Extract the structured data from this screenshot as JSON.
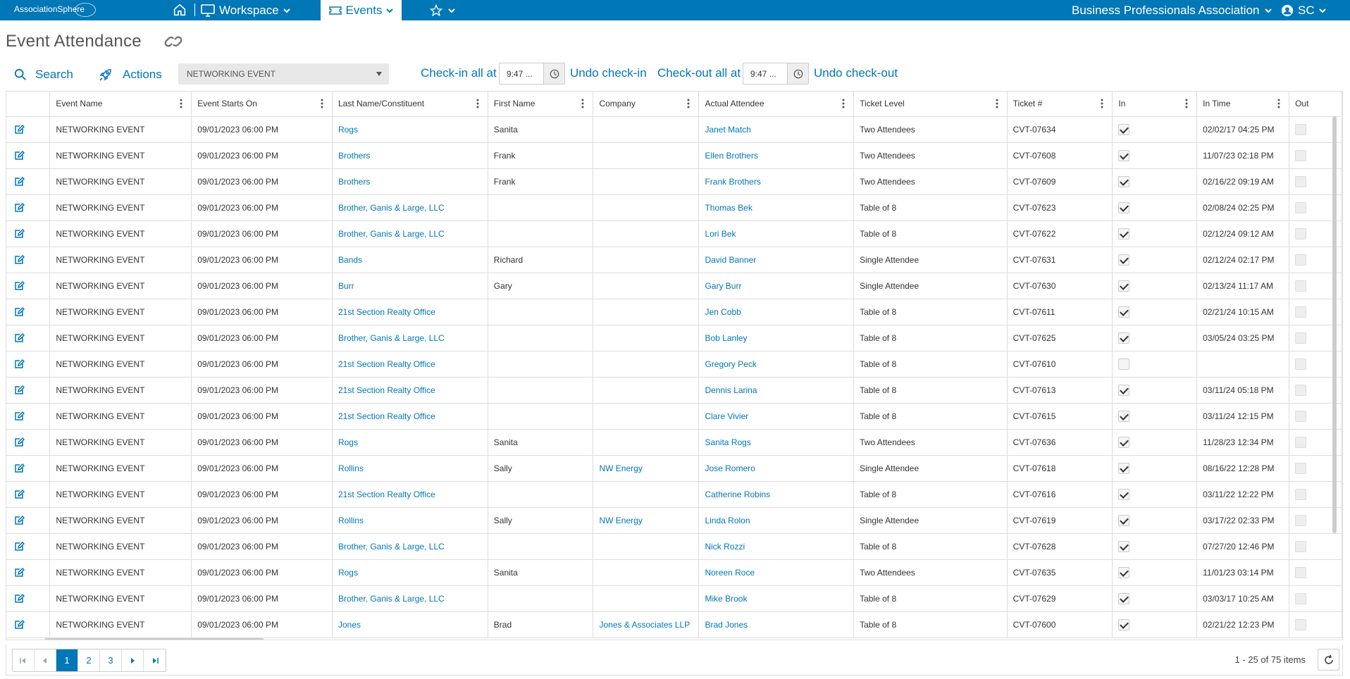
{
  "topbar": {
    "logo_text": "AssociationSphere",
    "workspace_label": "Workspace",
    "events_label": "Events",
    "org_name": "Business Professionals Association",
    "user_initials": "SC"
  },
  "page": {
    "title": "Event Attendance"
  },
  "toolbar": {
    "search_label": "Search",
    "actions_label": "Actions",
    "event_selected": "NETWORKING EVENT",
    "checkin_label": "Check-in all at",
    "checkin_time": "9:47 ...",
    "undo_checkin_label": "Undo check-in",
    "checkout_label": "Check-out all at",
    "checkout_time": "9:47 ...",
    "undo_checkout_label": "Undo check-out"
  },
  "grid": {
    "columns": [
      "Event Name",
      "Event Starts On",
      "Last Name/Constituent",
      "First Name",
      "Company",
      "Actual Attendee",
      "Ticket Level",
      "Ticket #",
      "In",
      "In Time",
      "Out"
    ],
    "rows": [
      {
        "event": "NETWORKING EVENT",
        "starts": "09/01/2023 06:00 PM",
        "last": "Rogs",
        "first": "Sanita",
        "company": "",
        "attendee": "Janet Match",
        "level": "Two Attendees",
        "ticket": "CVT-07634",
        "in": true,
        "in_time": "02/02/17 04:25 PM"
      },
      {
        "event": "NETWORKING EVENT",
        "starts": "09/01/2023 06:00 PM",
        "last": "Brothers",
        "first": "Frank",
        "company": "",
        "attendee": "Ellen Brothers",
        "level": "Two Attendees",
        "ticket": "CVT-07608",
        "in": true,
        "in_time": "11/07/23 02:18 PM"
      },
      {
        "event": "NETWORKING EVENT",
        "starts": "09/01/2023 06:00 PM",
        "last": "Brothers",
        "first": "Frank",
        "company": "",
        "attendee": "Frank Brothers",
        "level": "Two Attendees",
        "ticket": "CVT-07609",
        "in": true,
        "in_time": "02/16/22 09:19 AM"
      },
      {
        "event": "NETWORKING EVENT",
        "starts": "09/01/2023 06:00 PM",
        "last": "Brother, Ganis & Large, LLC",
        "first": "",
        "company": "",
        "attendee": "Thomas Bek",
        "level": "Table of 8",
        "ticket": "CVT-07623",
        "in": true,
        "in_time": "02/08/24 02:25 PM"
      },
      {
        "event": "NETWORKING EVENT",
        "starts": "09/01/2023 06:00 PM",
        "last": "Brother, Ganis & Large, LLC",
        "first": "",
        "company": "",
        "attendee": "Lori Bek",
        "level": "Table of 8",
        "ticket": "CVT-07622",
        "in": true,
        "in_time": "02/12/24 09:12 AM"
      },
      {
        "event": "NETWORKING EVENT",
        "starts": "09/01/2023 06:00 PM",
        "last": "Bands",
        "first": "Richard",
        "company": "",
        "attendee": "David Banner",
        "level": "Single Attendee",
        "ticket": "CVT-07631",
        "in": true,
        "in_time": "02/12/24 02:17 PM"
      },
      {
        "event": "NETWORKING EVENT",
        "starts": "09/01/2023 06:00 PM",
        "last": "Burr",
        "first": "Gary",
        "company": "",
        "attendee": "Gary Burr",
        "level": "Single Attendee",
        "ticket": "CVT-07630",
        "in": true,
        "in_time": "02/13/24 11:17 AM"
      },
      {
        "event": "NETWORKING EVENT",
        "starts": "09/01/2023 06:00 PM",
        "last": "21st Section Realty Office",
        "first": "",
        "company": "",
        "attendee": "Jen Cobb",
        "level": "Table of 8",
        "ticket": "CVT-07611",
        "in": true,
        "in_time": "02/21/24 10:15 AM"
      },
      {
        "event": "NETWORKING EVENT",
        "starts": "09/01/2023 06:00 PM",
        "last": "Brother, Ganis & Large, LLC",
        "first": "",
        "company": "",
        "attendee": "Bob Lanley",
        "level": "Table of 8",
        "ticket": "CVT-07625",
        "in": true,
        "in_time": "03/05/24 03:25 PM"
      },
      {
        "event": "NETWORKING EVENT",
        "starts": "09/01/2023 06:00 PM",
        "last": "21st Section Realty Office",
        "first": "",
        "company": "",
        "attendee": "Gregory Peck",
        "level": "Table of 8",
        "ticket": "CVT-07610",
        "in": false,
        "in_time": ""
      },
      {
        "event": "NETWORKING EVENT",
        "starts": "09/01/2023 06:00 PM",
        "last": "21st Section Realty Office",
        "first": "",
        "company": "",
        "attendee": "Dennis Larina",
        "level": "Table of 8",
        "ticket": "CVT-07613",
        "in": true,
        "in_time": "03/11/24 05:18 PM"
      },
      {
        "event": "NETWORKING EVENT",
        "starts": "09/01/2023 06:00 PM",
        "last": "21st Section Realty Office",
        "first": "",
        "company": "",
        "attendee": "Clare Vivier",
        "level": "Table of 8",
        "ticket": "CVT-07615",
        "in": true,
        "in_time": "03/11/24 12:15 PM"
      },
      {
        "event": "NETWORKING EVENT",
        "starts": "09/01/2023 06:00 PM",
        "last": "Rogs",
        "first": "Sanita",
        "company": "",
        "attendee": "Sanita Rogs",
        "level": "Two Attendees",
        "ticket": "CVT-07636",
        "in": true,
        "in_time": "11/28/23 12:34 PM"
      },
      {
        "event": "NETWORKING EVENT",
        "starts": "09/01/2023 06:00 PM",
        "last": "Rollins",
        "first": "Sally",
        "company": "NW Energy",
        "attendee": "Jose Romero",
        "level": "Single Attendee",
        "ticket": "CVT-07618",
        "in": true,
        "in_time": "08/16/22 12:28 PM"
      },
      {
        "event": "NETWORKING EVENT",
        "starts": "09/01/2023 06:00 PM",
        "last": "21st Section Realty Office",
        "first": "",
        "company": "",
        "attendee": "Catherine Robins",
        "level": "Table of 8",
        "ticket": "CVT-07616",
        "in": true,
        "in_time": "03/11/22 12:22 PM"
      },
      {
        "event": "NETWORKING EVENT",
        "starts": "09/01/2023 06:00 PM",
        "last": "Rollins",
        "first": "Sally",
        "company": "NW Energy",
        "attendee": "Linda Rolon",
        "level": "Single Attendee",
        "ticket": "CVT-07619",
        "in": true,
        "in_time": "03/17/22 02:33 PM"
      },
      {
        "event": "NETWORKING EVENT",
        "starts": "09/01/2023 06:00 PM",
        "last": "Brother, Ganis & Large, LLC",
        "first": "",
        "company": "",
        "attendee": "Nick Rozzi",
        "level": "Table of 8",
        "ticket": "CVT-07628",
        "in": true,
        "in_time": "07/27/20 12:46 PM"
      },
      {
        "event": "NETWORKING EVENT",
        "starts": "09/01/2023 06:00 PM",
        "last": "Rogs",
        "first": "Sanita",
        "company": "",
        "attendee": "Noreen Roce",
        "level": "Two Attendees",
        "ticket": "CVT-07635",
        "in": true,
        "in_time": "11/01/23 03:14 PM"
      },
      {
        "event": "NETWORKING EVENT",
        "starts": "09/01/2023 06:00 PM",
        "last": "Brother, Ganis & Large, LLC",
        "first": "",
        "company": "",
        "attendee": "Mike Brook",
        "level": "Table of 8",
        "ticket": "CVT-07629",
        "in": true,
        "in_time": "03/03/17 10:25 AM"
      },
      {
        "event": "NETWORKING EVENT",
        "starts": "09/01/2023 06:00 PM",
        "last": "Jones",
        "first": "Brad",
        "company": "Jones & Associates LLP",
        "attendee": "Brad Jones",
        "level": "Table of 8",
        "ticket": "CVT-07600",
        "in": true,
        "in_time": "02/21/22 12:23 PM"
      }
    ]
  },
  "pager": {
    "pages": [
      "1",
      "2",
      "3"
    ],
    "current_page": "1",
    "info": "1 - 25 of 75 items"
  },
  "colors": {
    "brand": "#0077b6",
    "link": "#0077b6"
  }
}
